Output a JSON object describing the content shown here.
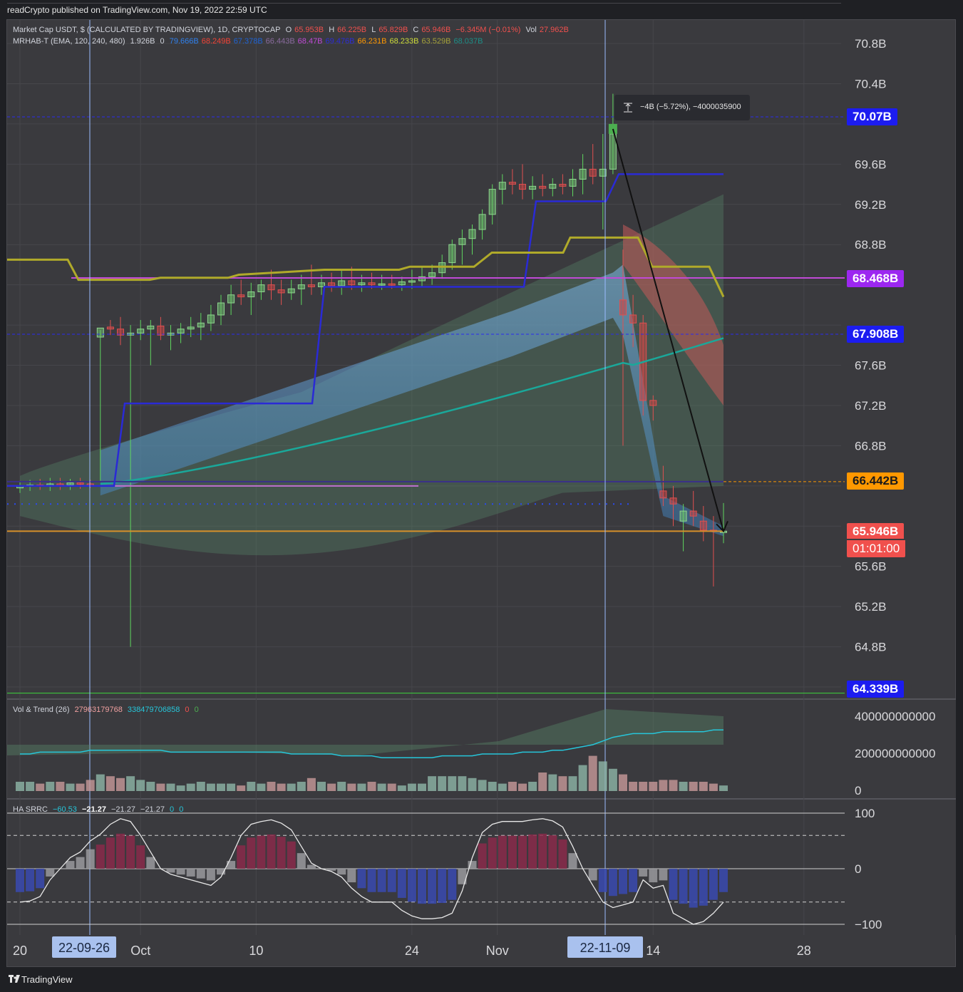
{
  "header": {
    "publisher": "readCrypto published on TradingView.com, Nov 19, 2022 22:59 UTC"
  },
  "footer": {
    "brand": "TradingView"
  },
  "legend_main": {
    "title": "Market Cap USDT, $ (CALCULATED BY TRADINGVIEW), 1D, CRYPTOCAP",
    "o_label": "O",
    "o_val": "65.953B",
    "h_label": "H",
    "h_val": "66.225B",
    "l_label": "L",
    "l_val": "65.829B",
    "c_label": "C",
    "c_val": "65.946B",
    "chg": "−6.345M (−0.01%)",
    "vol_label": "Vol",
    "vol_val": "27.962B"
  },
  "legend_mrhab": {
    "title": "MRHAB-T (EMA, 120, 240, 480)",
    "v1": "1.926B",
    "v2": "0",
    "vals": [
      "79.666B",
      "68.249B",
      "67.378B",
      "66.443B",
      "68.47B",
      "69.476B",
      "66.231B",
      "68.233B",
      "63.529B",
      "68.037B"
    ],
    "colors": [
      "#2f80ed",
      "#f44336",
      "#1e63d4",
      "#8a6b9e",
      "#c04ad6",
      "#2c2cd6",
      "#ff9800",
      "#cddc39",
      "#a5a23a",
      "#1c8f87"
    ]
  },
  "legend_vol": {
    "title": "Vol & Trend (26)",
    "v1": "27963179768",
    "v2": "338479706858",
    "v3": "0",
    "v4": "0"
  },
  "legend_ha": {
    "title": "HA SRRC",
    "v1": "−60.53",
    "v2": "−21.27",
    "v3": "−21.27",
    "v4": "−21.27",
    "v5": "0",
    "v6": "0"
  },
  "measure_tooltip": "−4B (−5.72%), −4000035900",
  "price_badges": [
    {
      "label": "70.07B",
      "bg": "#1c1cf0",
      "fg": "#ffffff"
    },
    {
      "label": "68.468B",
      "bg": "#9c27f0",
      "fg": "#ffffff"
    },
    {
      "label": "67.908B",
      "bg": "#1c1cf0",
      "fg": "#ffffff"
    },
    {
      "label": "66.442B",
      "bg": "#ff9800",
      "fg": "#1a1a1a"
    },
    {
      "label": "65.946B",
      "bg": "#f0504d",
      "fg": "#ffffff"
    },
    {
      "label": "01:01:00",
      "bg": "#f0504d",
      "fg": "#ffffff"
    },
    {
      "label": "64.339B",
      "bg": "#1c1cf0",
      "fg": "#ffffff"
    }
  ],
  "x_badges": [
    "22-09-26",
    "22-11-09"
  ],
  "chart_data": [
    {
      "type": "candlestick",
      "title": "Market Cap USDT",
      "x_ticks": [
        "20",
        "Oct",
        "10",
        "24",
        "Nov",
        "14",
        "28"
      ],
      "y_ticks": [
        "70.8B",
        "70.4B",
        "69.6B",
        "69.2B",
        "68.8B",
        "67.6B",
        "67.2B",
        "66.8B",
        "65.6B",
        "65.2B",
        "64.8B"
      ],
      "ylim": [
        64.3,
        71.1
      ],
      "ohlc": [
        [
          66.38,
          66.45,
          66.33,
          66.4
        ],
        [
          66.4,
          66.46,
          66.35,
          66.41
        ],
        [
          66.41,
          66.47,
          66.36,
          66.4
        ],
        [
          66.4,
          66.48,
          66.35,
          66.42
        ],
        [
          66.42,
          66.48,
          66.36,
          66.41
        ],
        [
          66.41,
          66.47,
          66.36,
          66.43
        ],
        [
          66.43,
          66.48,
          66.37,
          66.42
        ],
        [
          66.42,
          66.46,
          66.38,
          66.4
        ],
        [
          67.88,
          67.95,
          66.45,
          67.97
        ],
        [
          67.98,
          68.05,
          67.9,
          67.96
        ],
        [
          67.96,
          68.08,
          67.8,
          67.9
        ],
        [
          67.9,
          68.0,
          64.8,
          67.92
        ],
        [
          67.92,
          68.05,
          67.85,
          67.96
        ],
        [
          67.96,
          68.05,
          67.6,
          67.99
        ],
        [
          67.99,
          68.08,
          67.85,
          67.9
        ],
        [
          67.9,
          68.0,
          67.75,
          67.92
        ],
        [
          67.92,
          68.02,
          67.82,
          67.96
        ],
        [
          67.96,
          68.08,
          67.88,
          67.98
        ],
        [
          67.98,
          68.12,
          67.85,
          68.02
        ],
        [
          68.02,
          68.2,
          67.94,
          68.1
        ],
        [
          68.1,
          68.3,
          68.0,
          68.22
        ],
        [
          68.22,
          68.4,
          68.1,
          68.3
        ],
        [
          68.3,
          68.45,
          68.2,
          68.28
        ],
        [
          68.28,
          68.42,
          68.1,
          68.33
        ],
        [
          68.33,
          68.45,
          68.25,
          68.4
        ],
        [
          68.4,
          68.55,
          68.25,
          68.35
        ],
        [
          68.35,
          68.45,
          68.2,
          68.32
        ],
        [
          68.32,
          68.45,
          68.25,
          68.36
        ],
        [
          68.36,
          68.5,
          68.2,
          68.4
        ],
        [
          68.4,
          68.6,
          68.3,
          68.38
        ],
        [
          68.38,
          68.5,
          68.3,
          68.42
        ],
        [
          68.42,
          68.52,
          68.33,
          68.39
        ],
        [
          68.39,
          68.55,
          68.3,
          68.44
        ],
        [
          68.44,
          68.58,
          68.35,
          68.4
        ],
        [
          68.4,
          68.5,
          68.33,
          68.42
        ],
        [
          68.42,
          68.52,
          68.36,
          68.4
        ],
        [
          68.4,
          68.5,
          68.35,
          68.41
        ],
        [
          68.41,
          68.5,
          68.36,
          68.4
        ],
        [
          68.4,
          68.48,
          68.34,
          68.43
        ],
        [
          68.43,
          68.55,
          68.36,
          68.44
        ],
        [
          68.44,
          68.58,
          68.38,
          68.48
        ],
        [
          68.48,
          68.6,
          68.4,
          68.52
        ],
        [
          68.52,
          68.7,
          68.46,
          68.62
        ],
        [
          68.62,
          68.85,
          68.55,
          68.8
        ],
        [
          68.8,
          68.95,
          68.6,
          68.86
        ],
        [
          68.86,
          69.0,
          68.7,
          68.95
        ],
        [
          68.95,
          69.15,
          68.85,
          69.1
        ],
        [
          69.1,
          69.4,
          69.0,
          69.35
        ],
        [
          69.35,
          69.5,
          69.2,
          69.42
        ],
        [
          69.42,
          69.55,
          69.3,
          69.4
        ],
        [
          69.4,
          69.6,
          69.25,
          69.35
        ],
        [
          69.35,
          69.48,
          69.25,
          69.38
        ],
        [
          69.38,
          69.5,
          69.28,
          69.36
        ],
        [
          69.36,
          69.46,
          69.28,
          69.4
        ],
        [
          69.4,
          69.5,
          69.3,
          69.38
        ],
        [
          69.38,
          69.55,
          69.28,
          69.45
        ],
        [
          69.45,
          69.7,
          69.3,
          69.55
        ],
        [
          69.55,
          69.8,
          69.4,
          69.48
        ],
        [
          69.48,
          69.9,
          68.95,
          69.55
        ],
        [
          69.55,
          70.3,
          69.5,
          69.9
        ],
        [
          68.25,
          68.75,
          66.8,
          68.1
        ],
        [
          68.1,
          68.3,
          67.78,
          68.02
        ],
        [
          68.02,
          68.1,
          67.1,
          67.25
        ],
        [
          67.25,
          67.3,
          67.05,
          67.2
        ],
        [
          66.35,
          66.6,
          66.2,
          66.28
        ],
        [
          66.28,
          66.4,
          66.0,
          66.22
        ],
        [
          66.05,
          66.22,
          65.75,
          66.15
        ],
        [
          66.15,
          66.35,
          66.0,
          66.1
        ],
        [
          66.05,
          66.2,
          65.85,
          65.96
        ],
        [
          65.96,
          66.1,
          65.4,
          65.95
        ],
        [
          65.95,
          66.23,
          65.83,
          65.95
        ]
      ],
      "overlays": [
        {
          "name": "70.07B",
          "value": 70.07
        },
        {
          "name": "68.468B",
          "value": 68.468
        },
        {
          "name": "67.908B",
          "value": 67.908
        },
        {
          "name": "66.442B",
          "value": 66.442
        },
        {
          "name": "64.339B",
          "value": 64.339
        }
      ]
    },
    {
      "type": "bar",
      "title": "Vol & Trend (26)",
      "y_ticks": [
        "400000000000",
        "200000000000",
        "0"
      ],
      "ylim": [
        0,
        470000000000
      ],
      "values": [
        5,
        5,
        4,
        5,
        5,
        4,
        4,
        6,
        9,
        8,
        7,
        8,
        6,
        5,
        4,
        4,
        3,
        4,
        5,
        4,
        4,
        4,
        3,
        5,
        4,
        5,
        4,
        4,
        5,
        7,
        5,
        4,
        5,
        4,
        4,
        5,
        4,
        4,
        3,
        4,
        4,
        8,
        8,
        8,
        8,
        7,
        6,
        5,
        4,
        5,
        4,
        5,
        10,
        9,
        8,
        8,
        14,
        19,
        16,
        12,
        9,
        5,
        5,
        5,
        6,
        6,
        5,
        5,
        5,
        4,
        3
      ],
      "trend": [
        20,
        20,
        21,
        21,
        21,
        21,
        21,
        22,
        22,
        22,
        22,
        22,
        22,
        22,
        22,
        21,
        21,
        21,
        21,
        21,
        21,
        21,
        21,
        21,
        21,
        21,
        21,
        20,
        20,
        20,
        20,
        20,
        19,
        19,
        19,
        19,
        18,
        18,
        18,
        18,
        18,
        18,
        19,
        19,
        19,
        19,
        20,
        20,
        20,
        20,
        21,
        21,
        21,
        22,
        22,
        23,
        24,
        25,
        27,
        29,
        30,
        31,
        31,
        31,
        32,
        32,
        32,
        32,
        32,
        33,
        33
      ]
    },
    {
      "type": "line",
      "title": "HA SRRC",
      "y_ticks": [
        "100",
        "0",
        "−100"
      ],
      "ylim": [
        -110,
        110
      ],
      "values": [
        -60,
        -58,
        -50,
        -20,
        0,
        20,
        30,
        50,
        62,
        80,
        90,
        85,
        60,
        30,
        0,
        -10,
        -15,
        -20,
        -25,
        -30,
        -15,
        20,
        60,
        80,
        85,
        88,
        82,
        70,
        40,
        10,
        0,
        -5,
        -15,
        -35,
        -50,
        -60,
        -60,
        -60,
        -75,
        -85,
        -90,
        -90,
        -88,
        -80,
        -40,
        20,
        65,
        80,
        85,
        85,
        85,
        88,
        90,
        86,
        75,
        40,
        0,
        -30,
        -60,
        -70,
        -65,
        -60,
        -20,
        -35,
        -30,
        -80,
        -90,
        -100,
        -95,
        -80,
        -60,
        -40,
        -21
      ]
    }
  ]
}
